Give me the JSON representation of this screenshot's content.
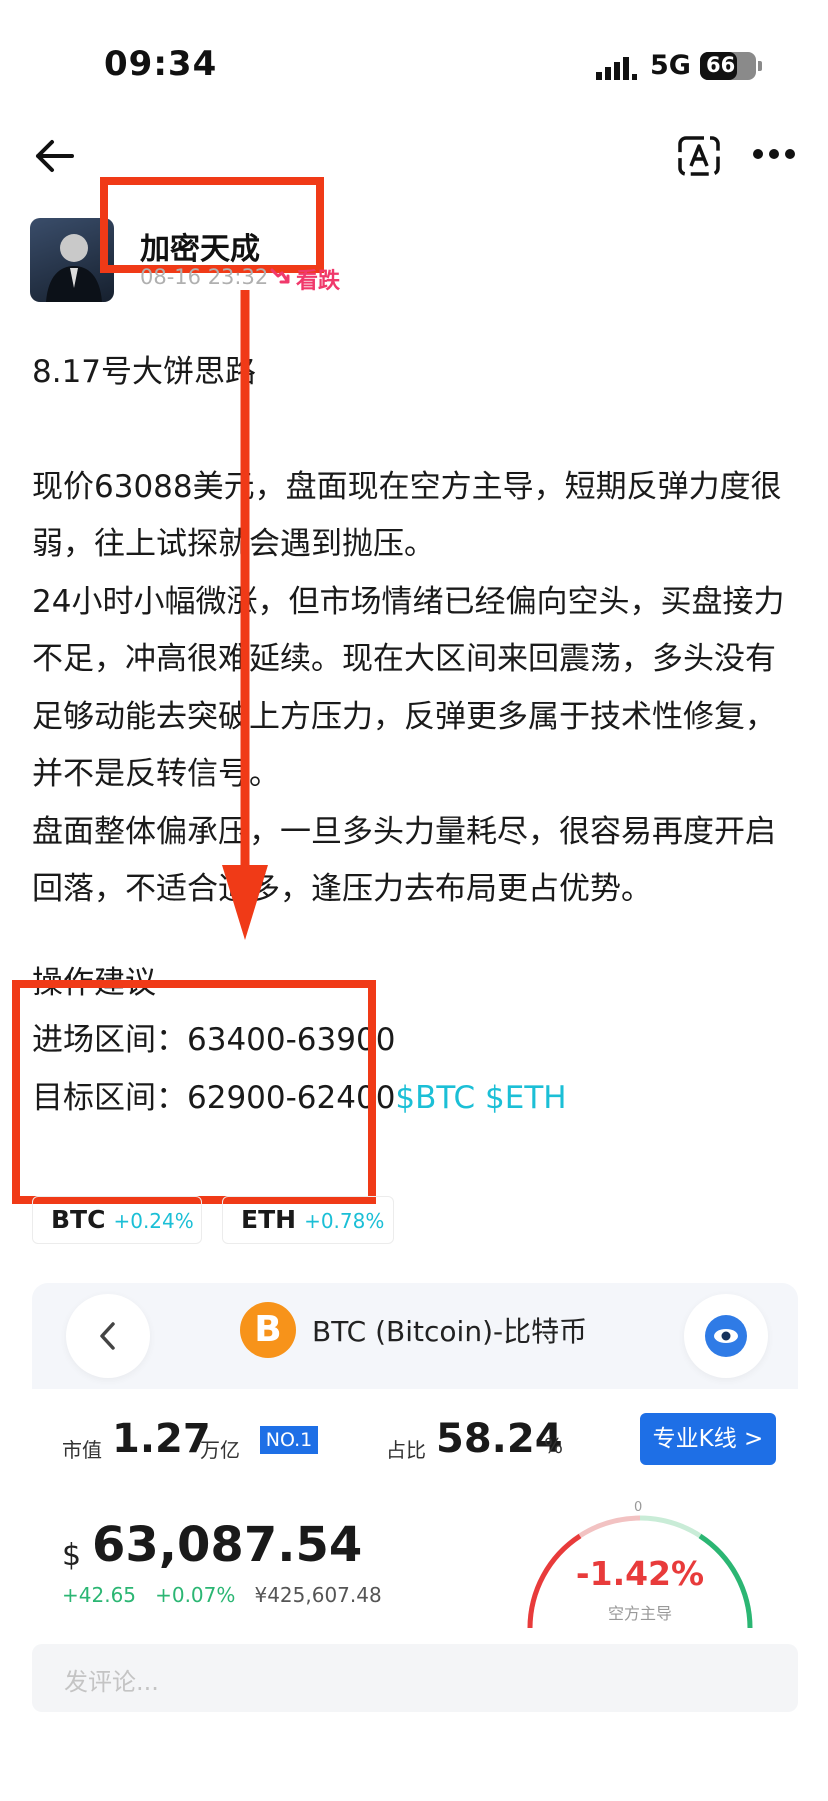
{
  "status_bar": {
    "time": "09:34",
    "network": "5G",
    "battery": "66",
    "battery_level_percent": 66
  },
  "nav": {
    "back_icon": "arrow-left-icon",
    "translate_icon": "translate-icon",
    "more_icon": "more-icon"
  },
  "author": {
    "name": "加密天成",
    "timestamp": "08-16 23:32",
    "sentiment": "看跌",
    "sentiment_icon": "trend-down-icon"
  },
  "post": {
    "title": "8.17号大饼思路",
    "paragraphs": [
      "现价63088美元，盘面现在空方主导，短期反弹力度很弱，往上试探就会遇到抛压。",
      "24小时小幅微涨，但市场情绪已经偏向空头，买盘接力不足，冲高很难延续。现在大区间来回震荡，多头没有足够动能去突破上方压力，反弹更多属于技术性修复，并不是反转信号。",
      "盘面整体偏承压，一旦多头力量耗尽，很容易再度开启回落，不适合追多，逢压力去布局更占优势。"
    ],
    "advice_title": "操作建议",
    "entry": "进场区间：63400-63900",
    "target": "目标区间：62900-62400",
    "tags": [
      "$BTC",
      "$ETH"
    ]
  },
  "coins": [
    {
      "symbol": "BTC",
      "change": "+0.24%"
    },
    {
      "symbol": "ETH",
      "change": "+0.78%"
    }
  ],
  "card": {
    "title": "BTC (Bitcoin)-比特币",
    "logo_glyph": "B",
    "market_cap_label": "市值",
    "market_cap_value": "1.27",
    "market_cap_unit": "万亿",
    "rank": "NO.1",
    "share_label": "占比",
    "share_value": "58.24",
    "share_unit": "%",
    "kline_button": "专业K线 >",
    "currency_symbol": "$",
    "price": "63,087.54",
    "change_abs": "+42.65",
    "change_pct": "+0.07%",
    "price_cny": "¥425,607.48",
    "gauge_value": "-1.42%",
    "gauge_label": "空方主导",
    "gauge_zero": "0"
  },
  "comment": {
    "placeholder": "发评论..."
  },
  "colors": {
    "highlight_box": "#f03a17",
    "accent_blue": "#1e6fe6",
    "tag_cyan": "#1bbfd6",
    "bearish_pink": "#f0396b",
    "bull_green": "#2bb673",
    "bear_red": "#e83b3b"
  }
}
